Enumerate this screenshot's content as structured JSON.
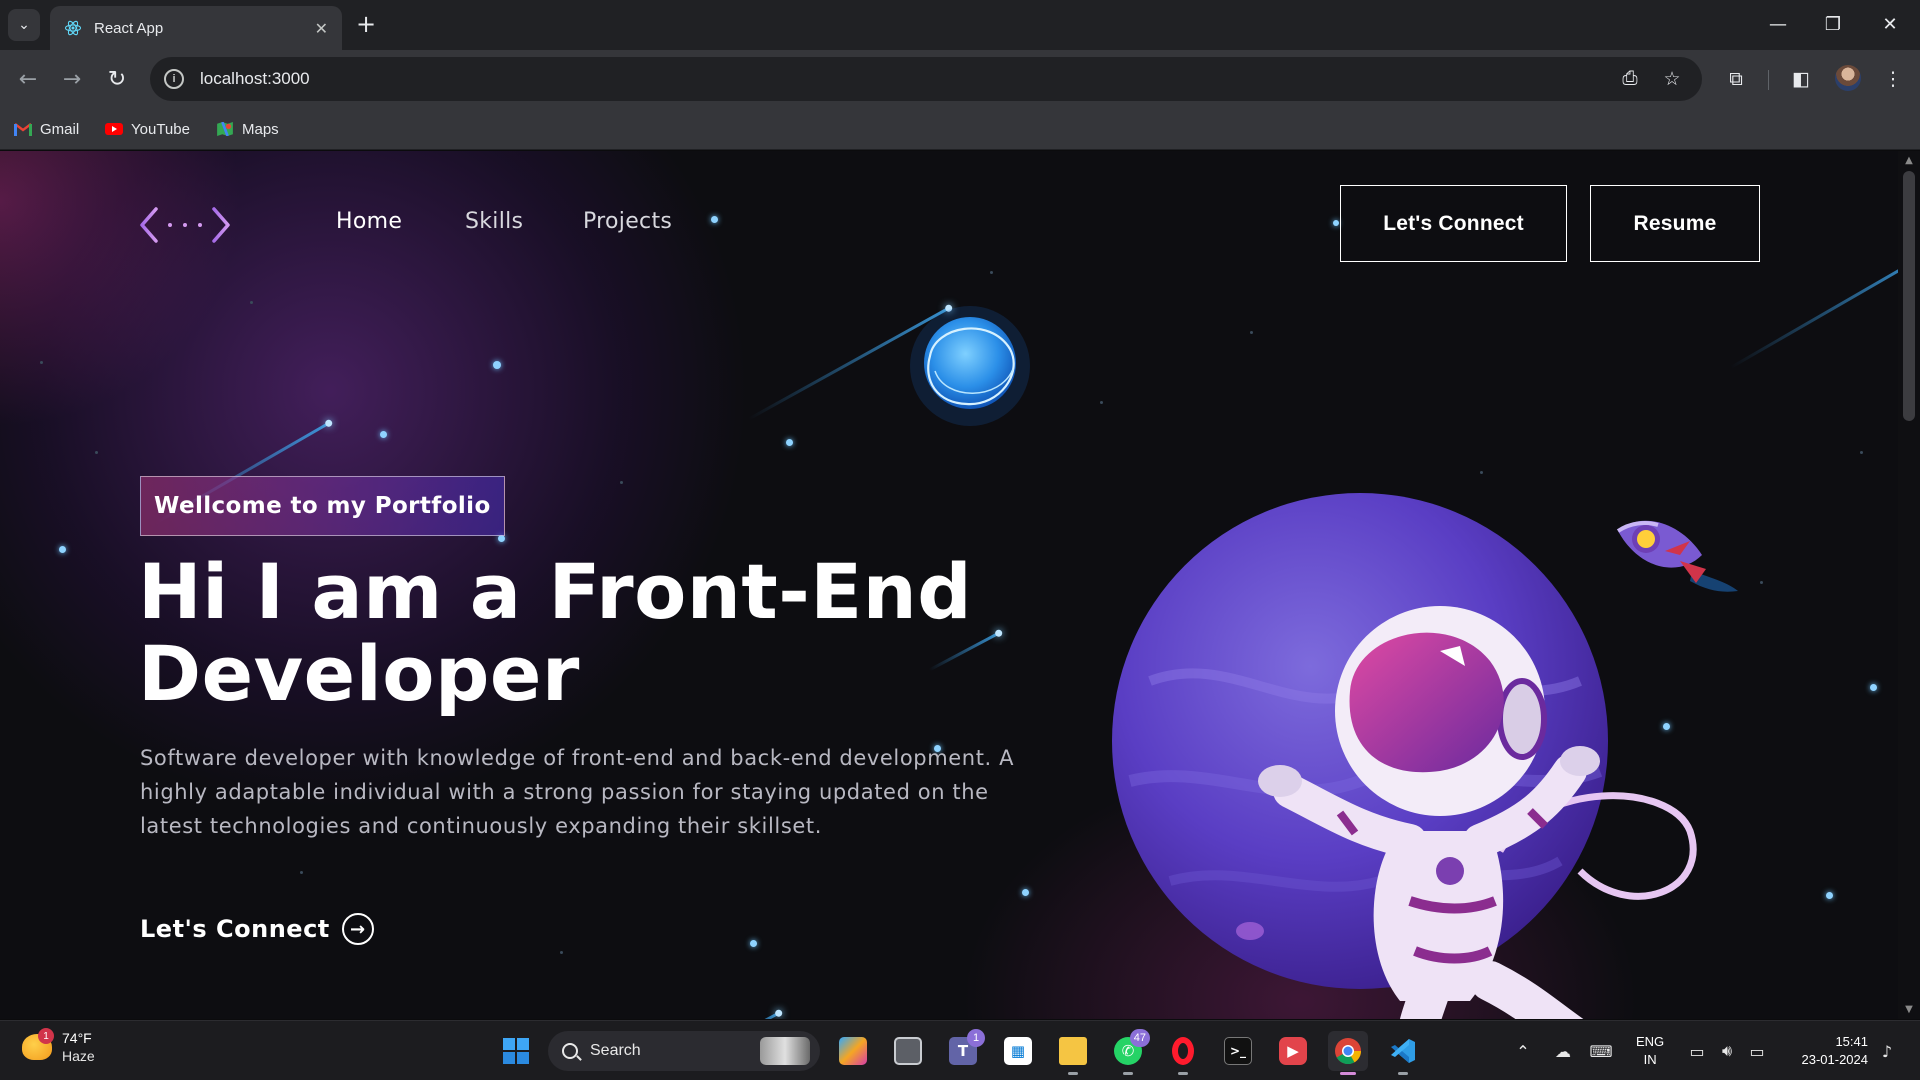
{
  "browser": {
    "tab_title": "React App",
    "url": "localhost:3000",
    "bookmarks": [
      {
        "label": "Gmail",
        "icon": "gmail-icon"
      },
      {
        "label": "YouTube",
        "icon": "youtube-icon"
      },
      {
        "label": "Maps",
        "icon": "maps-icon"
      }
    ]
  },
  "page": {
    "nav_links": [
      "Home",
      "Skills",
      "Projects"
    ],
    "connect_button": "Let's Connect",
    "resume_button": "Resume",
    "tagline": "Wellcome to my Portfolio",
    "headline_line1": "Hi I am a Front-End",
    "headline_line2": "Developer",
    "bio": "Software developer with knowledge of front-end and back-end development. A highly adaptable individual with a strong passion for staying updated on the latest technologies and continuously expanding their skillset.",
    "cta_label": "Let's Connect",
    "cta_icon": "arrow-right-circle-icon",
    "colors": {
      "tag_gradient_start": "#aa367c",
      "tag_gradient_end": "#4a2fbd",
      "background": "#0d0d11"
    }
  },
  "taskbar": {
    "weather_temp": "74°F",
    "weather_desc": "Haze",
    "weather_badge": "1",
    "search_placeholder": "Search",
    "teams_badge": "1",
    "whatsapp_badge": "47",
    "lang_line1": "ENG",
    "lang_line2": "IN",
    "time": "15:41",
    "date": "23-01-2024"
  }
}
